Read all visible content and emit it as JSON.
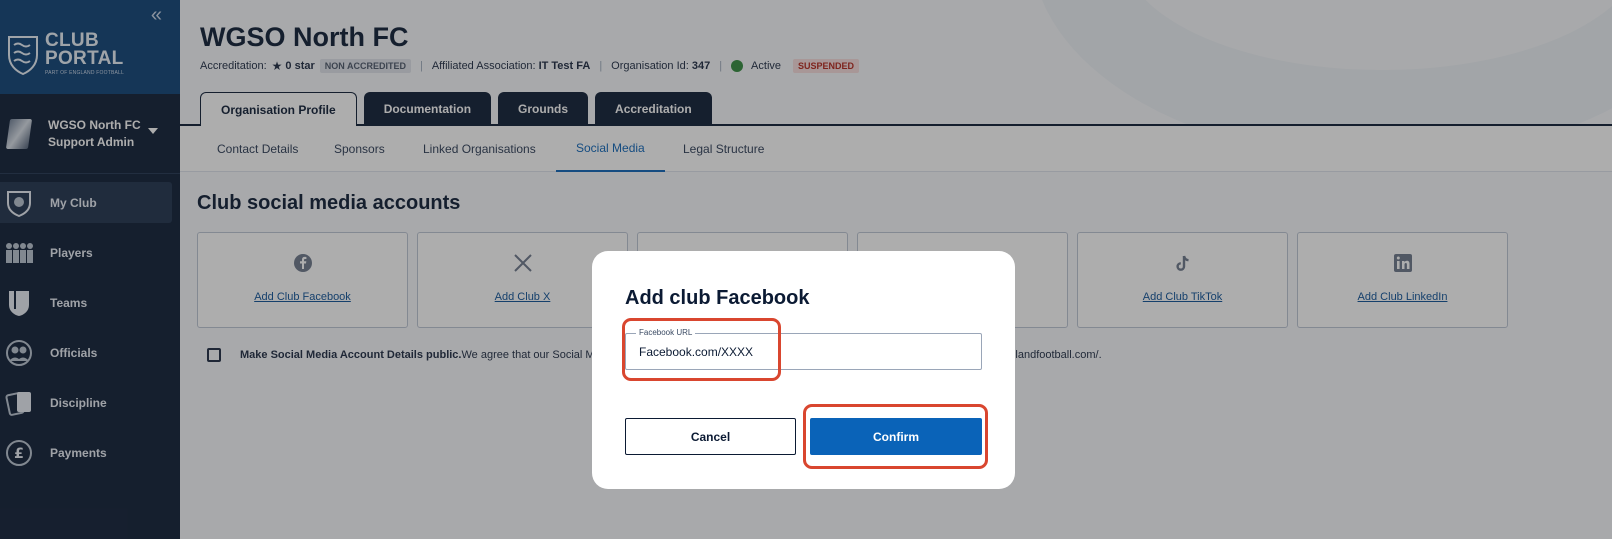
{
  "sidebar": {
    "collapse_glyph": "«",
    "logo_line1": "CLUB",
    "logo_line2": "PORTAL",
    "logo_sub": "PART OF ENGLAND FOOTBALL",
    "user_name": "WGSO North FC",
    "user_role": "Support Admin",
    "items": [
      {
        "label": "My Club",
        "icon": "club-crest-icon",
        "active": true
      },
      {
        "label": "Players",
        "icon": "players-icon",
        "active": false
      },
      {
        "label": "Teams",
        "icon": "shirt-icon",
        "active": false
      },
      {
        "label": "Officials",
        "icon": "officials-icon",
        "active": false
      },
      {
        "label": "Discipline",
        "icon": "cards-icon",
        "active": false
      },
      {
        "label": "Payments",
        "icon": "pound-icon",
        "active": false
      }
    ]
  },
  "header": {
    "org_name": "WGSO North FC",
    "accreditation_label": "Accreditation:",
    "accreditation_stars": "0 star",
    "accreditation_badge": "NON ACCREDITED",
    "affiliated_label": "Affiliated Association:",
    "affiliated_value": "IT Test FA",
    "org_id_label": "Organisation Id:",
    "org_id_value": "347",
    "status": "Active",
    "status_badge": "SUSPENDED"
  },
  "tabs": [
    "Organisation Profile",
    "Documentation",
    "Grounds",
    "Accreditation"
  ],
  "subtabs": [
    "Contact Details",
    "Sponsors",
    "Linked Organisations",
    "Social Media",
    "Legal Structure"
  ],
  "section_title": "Club social media accounts",
  "cards": [
    {
      "link": "Add Club Facebook",
      "icon": "facebook-icon"
    },
    {
      "link": "Add Club X",
      "icon": "x-icon"
    },
    {
      "link": "",
      "icon": ""
    },
    {
      "link": "",
      "icon": ""
    },
    {
      "link": "Add Club TikTok",
      "icon": "tiktok-icon"
    },
    {
      "link": "Add Club LinkedIn",
      "icon": "linkedin-icon"
    }
  ],
  "public_row": {
    "bold": "Make Social Media Account Details public.",
    "text_start": " We agree that our Social Media Ac",
    "text_end": ".englandfootball.com/."
  },
  "modal": {
    "title": "Add club Facebook",
    "field_label": "Facebook URL",
    "field_value": "Facebook.com/XXXX",
    "cancel": "Cancel",
    "confirm": "Confirm"
  },
  "colors": {
    "navy": "#0b1a33",
    "primary_blue": "#0a63b8",
    "highlight": "#d9462f",
    "active_green": "#2f8a3b"
  }
}
